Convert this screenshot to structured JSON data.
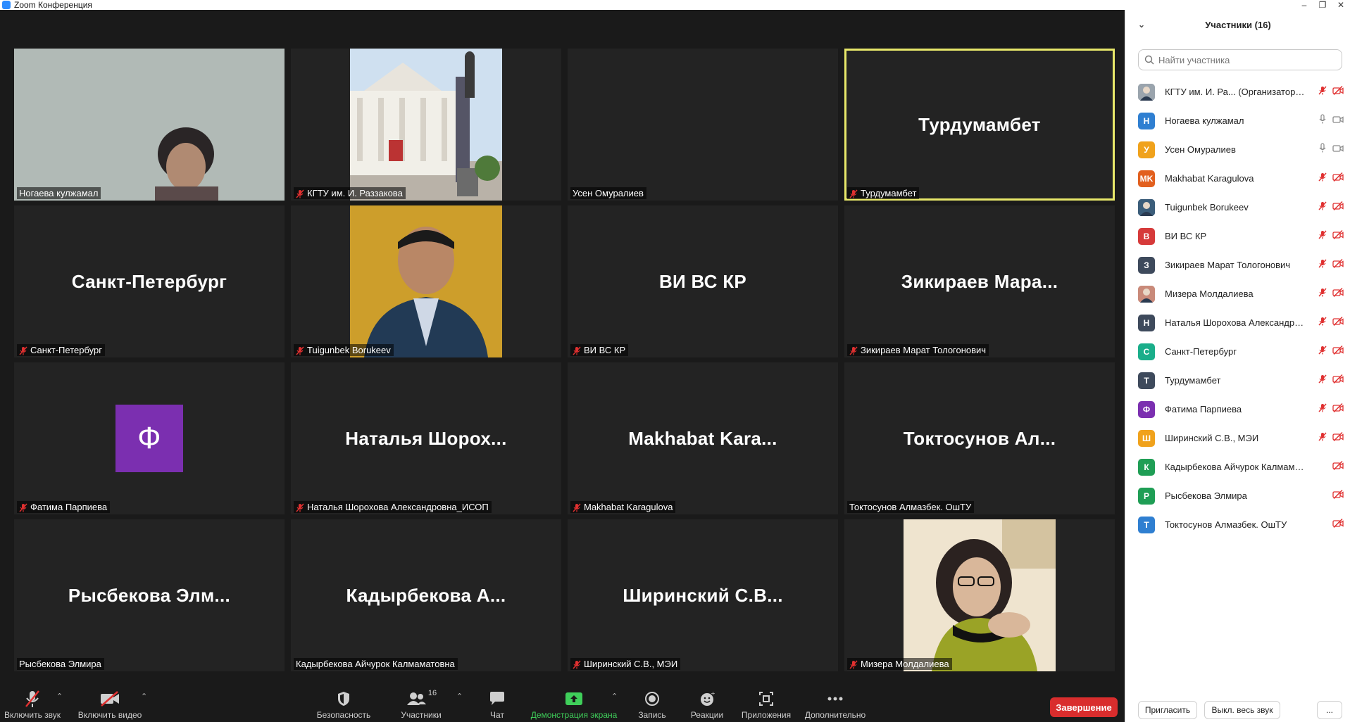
{
  "window": {
    "title": "Zoom Конференция"
  },
  "tiles": [
    {
      "name": "Ногаева кулжамал",
      "big": "",
      "muted": false,
      "kind": "photo-woman"
    },
    {
      "name": "КГТУ им. И. Раззакова",
      "big": "",
      "muted": true,
      "kind": "photo-building"
    },
    {
      "name": "Усен Омуралиев",
      "big": "",
      "muted": false,
      "kind": "blank"
    },
    {
      "name": "Турдумамбет",
      "big": "Турдумамбет",
      "muted": true,
      "kind": "text",
      "active": true
    },
    {
      "name": "Санкт-Петербург",
      "big": "Санкт-Петербург",
      "muted": true,
      "kind": "text"
    },
    {
      "name": "Tuigunbek Borukeev",
      "big": "",
      "muted": true,
      "kind": "photo-man"
    },
    {
      "name": "ВИ ВС КР",
      "big": "ВИ ВС КР",
      "muted": true,
      "kind": "text"
    },
    {
      "name": "Зикираев Марат Тологонович",
      "big": "Зикираев Мара...",
      "muted": true,
      "kind": "text"
    },
    {
      "name": "Фатима Парпиева",
      "big": "Ф",
      "muted": true,
      "kind": "avatar"
    },
    {
      "name": "Наталья Шорохова Александровна_ИСОП",
      "big": "Наталья Шорох...",
      "muted": true,
      "kind": "text"
    },
    {
      "name": "Makhabat Karagulova",
      "big": "Makhabat Kara...",
      "muted": true,
      "kind": "text"
    },
    {
      "name": "Токтосунов Алмазбек.   ОшТУ",
      "big": "Токтосунов Ал...",
      "muted": false,
      "kind": "text"
    },
    {
      "name": "Рысбекова Элмира",
      "big": "Рысбекова Элм...",
      "muted": false,
      "kind": "text"
    },
    {
      "name": "Кадырбекова Айчурок Калмаматовна",
      "big": "Кадырбекова А...",
      "muted": false,
      "kind": "text"
    },
    {
      "name": "Ширинский С.В., МЭИ",
      "big": "Ширинский С.В...",
      "muted": true,
      "kind": "text"
    },
    {
      "name": "Мизера Молдалиева",
      "big": "",
      "muted": true,
      "kind": "photo-woman2"
    }
  ],
  "toolbar": {
    "unmute": "Включить звук",
    "start_video": "Включить видео",
    "security": "Безопасность",
    "participants": "Участники",
    "participants_count": "16",
    "chat": "Чат",
    "share": "Демонстрация экрана",
    "record": "Запись",
    "reactions": "Реакции",
    "apps": "Приложения",
    "more": "Дополнительно",
    "end": "Завершение"
  },
  "panel": {
    "title": "Участники (16)",
    "search_placeholder": "Найти участника",
    "invite": "Пригласить",
    "mute_all": "Выкл. весь звук",
    "more": "...",
    "participants": [
      {
        "initials": "",
        "color": "#9aa4ad",
        "name": "КГТУ им. И. Ра...  (Организатор, я)",
        "mic": "off",
        "video": "off",
        "photo": "building"
      },
      {
        "initials": "Н",
        "color": "#2f7fd1",
        "name": "Ногаева кулжамал",
        "mic": "on",
        "video": "on"
      },
      {
        "initials": "У",
        "color": "#f0a21c",
        "name": "Усен Омуралиев",
        "mic": "on",
        "video": "on"
      },
      {
        "initials": "MK",
        "color": "#e2601f",
        "name": "Makhabat Karagulova",
        "mic": "off",
        "video": "off"
      },
      {
        "initials": "",
        "color": "#3b5d7a",
        "name": "Tuigunbek Borukeev",
        "mic": "off",
        "video": "off",
        "photo": "man"
      },
      {
        "initials": "В",
        "color": "#d63a3a",
        "name": "ВИ ВС КР",
        "mic": "off",
        "video": "off"
      },
      {
        "initials": "З",
        "color": "#3e4a5c",
        "name": "Зикираев Марат Тологонович",
        "mic": "off",
        "video": "off"
      },
      {
        "initials": "",
        "color": "#c98a7a",
        "name": "Мизера Молдалиева",
        "mic": "off",
        "video": "off",
        "photo": "woman"
      },
      {
        "initials": "Н",
        "color": "#3e4a5c",
        "name": "Наталья Шорохова Александро...",
        "mic": "off",
        "video": "off"
      },
      {
        "initials": "С",
        "color": "#1aae8a",
        "name": "Санкт-Петербург",
        "mic": "off",
        "video": "off"
      },
      {
        "initials": "Т",
        "color": "#3e4a5c",
        "name": "Турдумамбет",
        "mic": "off",
        "video": "off"
      },
      {
        "initials": "Ф",
        "color": "#7b2fb0",
        "name": "Фатима Парпиева",
        "mic": "off",
        "video": "off"
      },
      {
        "initials": "Ш",
        "color": "#f0a21c",
        "name": "Ширинский С.В., МЭИ",
        "mic": "off",
        "video": "off"
      },
      {
        "initials": "К",
        "color": "#1f9e55",
        "name": "Кадырбекова Айчурок Калмаматов...",
        "mic": "none",
        "video": "off"
      },
      {
        "initials": "Р",
        "color": "#1f9e55",
        "name": "Рысбекова Элмира",
        "mic": "none",
        "video": "off"
      },
      {
        "initials": "Т",
        "color": "#2f7fd1",
        "name": "Токтосунов Алмазбек.   ОшТУ",
        "mic": "none",
        "video": "off"
      }
    ]
  }
}
